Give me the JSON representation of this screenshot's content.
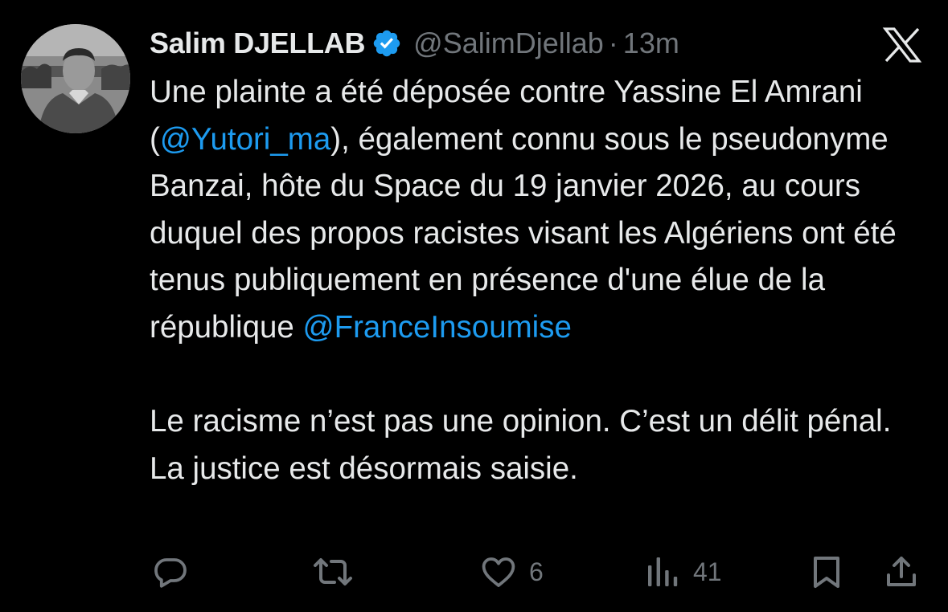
{
  "tweet": {
    "display_name": "Salim DJELLAB",
    "handle": "@SalimDjellab",
    "separator": "·",
    "time": "13m",
    "paragraph1": {
      "part1": "Une plainte a été déposée contre Yassine El Amrani (",
      "mention1": "@Yutori_ma",
      "part2": "), également connu sous le pseudonyme Banzai, hôte du Space du 19 janvier 2026, au cours duquel des propos racistes visant les Algériens ont été tenus publiquement en présence d'une élue de la république ",
      "mention2": "@FranceInsoumise"
    },
    "paragraph2": "Le racisme n’est pas une opinion. C’est un délit pénal. La justice est désormais saisie."
  },
  "actions": {
    "reply_count": "",
    "retweet_count": "",
    "like_count": "6",
    "views_count": "41"
  },
  "icons": {
    "verified": "verified-badge-icon",
    "logo": "x-logo-icon",
    "reply": "reply-icon",
    "retweet": "retweet-icon",
    "like": "heart-icon",
    "views": "views-chart-icon",
    "bookmark": "bookmark-icon",
    "share": "share-icon"
  },
  "colors": {
    "background": "#000000",
    "text": "#e7e9ea",
    "secondary": "#71767b",
    "accent": "#1d9bf0"
  }
}
